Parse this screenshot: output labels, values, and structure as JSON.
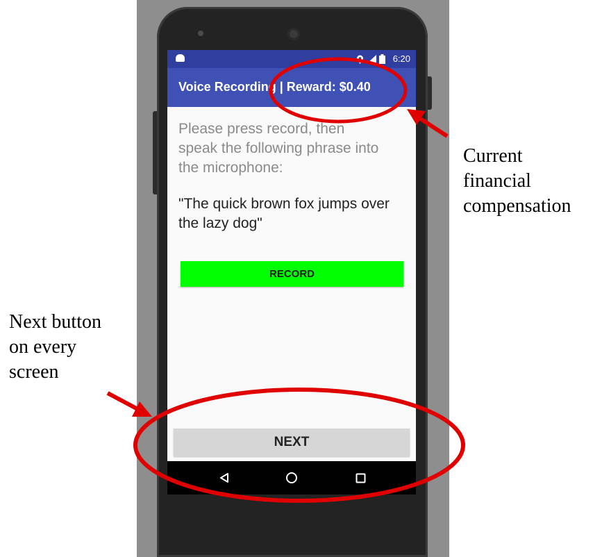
{
  "status_bar": {
    "time": "6:20",
    "icons": [
      "android-icon",
      "location-icon",
      "signal-icon",
      "battery-icon"
    ]
  },
  "app_bar": {
    "title": "Voice Recording | Reward: $0.40"
  },
  "content": {
    "instruction": "Please press record, then speak the following phrase into the microphone:",
    "phrase": "\"The quick brown fox jumps over the lazy dog\"",
    "record_label": "RECORD",
    "next_label": "NEXT"
  },
  "nav_bar": {
    "icons": [
      "back-icon",
      "home-icon",
      "recents-icon"
    ]
  },
  "annotations": {
    "reward_note_lines": [
      "Current",
      "financial",
      "compensation"
    ],
    "next_note_lines": [
      "Next button",
      "on every",
      "screen"
    ]
  },
  "colors": {
    "status_bar": "#303f9f",
    "app_bar": "#3f51b5",
    "record_button": "#00ff00",
    "next_button": "#d6d6d6",
    "annotation_red": "#e00000"
  }
}
